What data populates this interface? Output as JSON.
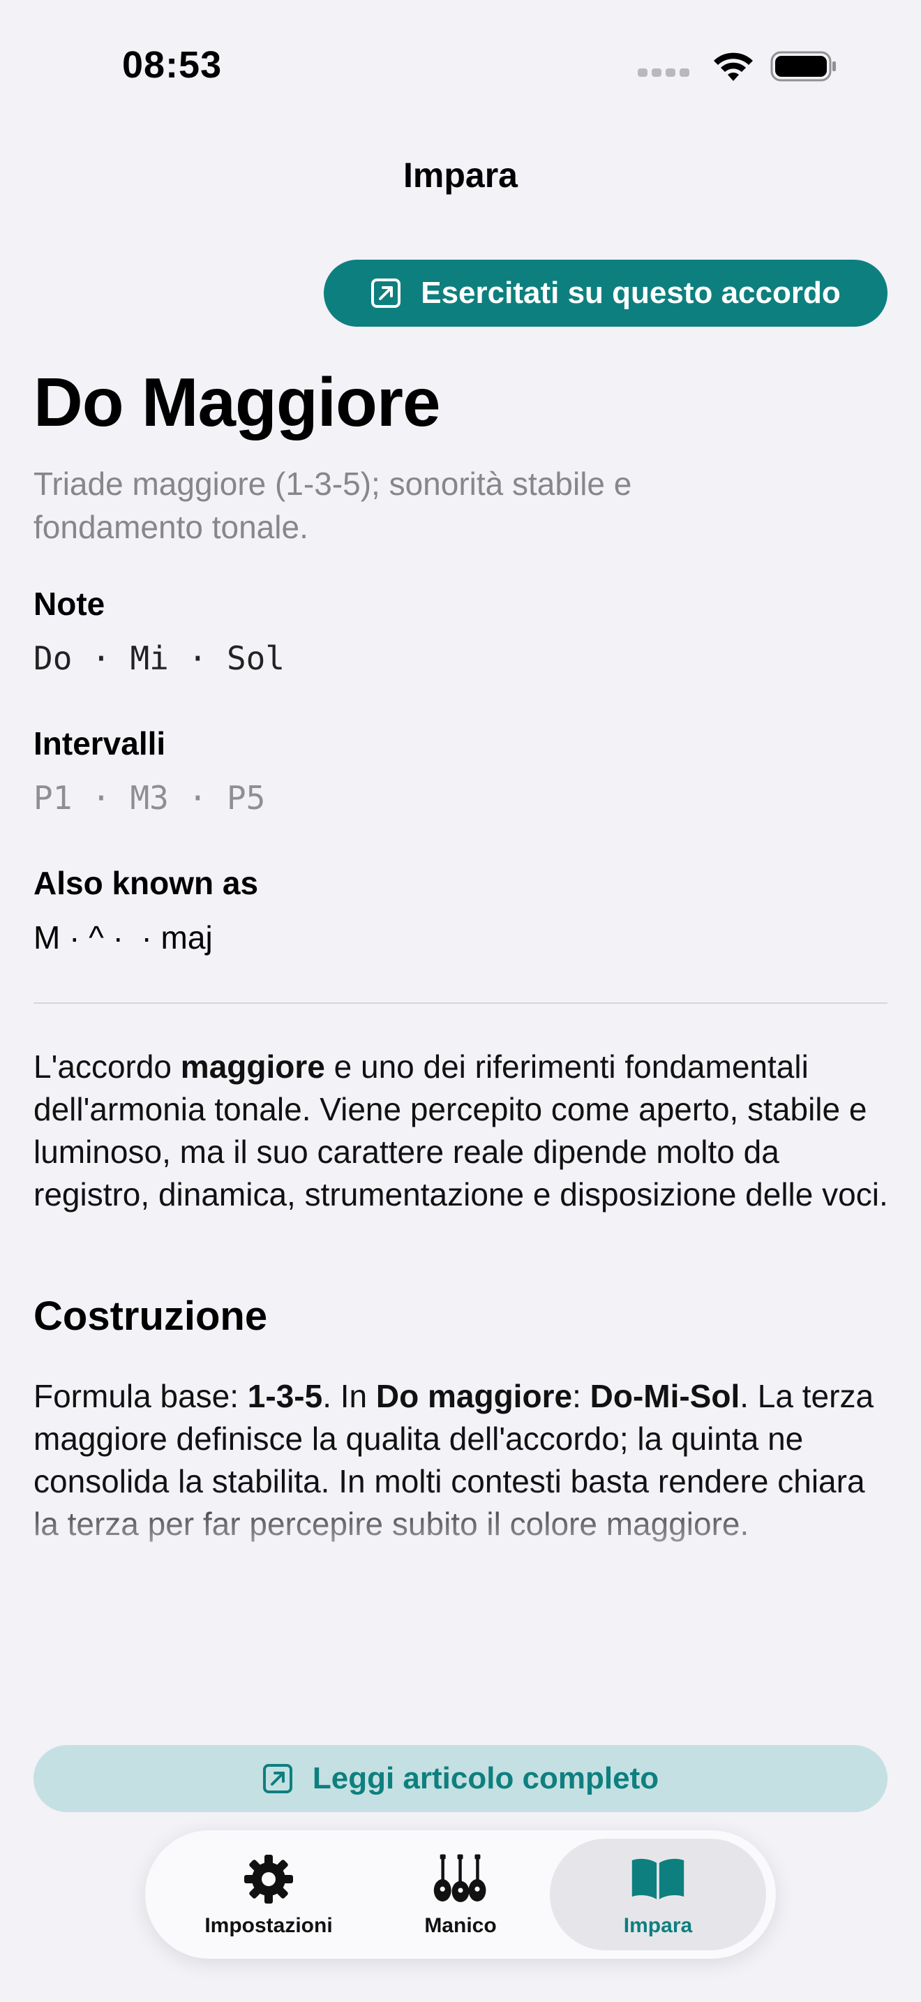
{
  "status": {
    "time": "08:53"
  },
  "nav": {
    "title": "Impara"
  },
  "practice_button": {
    "label": "Esercitati su questo accordo"
  },
  "chord": {
    "name": "Do Maggiore",
    "description": "Triade maggiore (1-3-5); sonorità stabile e fondamento tonale.",
    "notes_label": "Note",
    "notes": "Do · Mi · Sol",
    "intervals_label": "Intervalli",
    "intervals": "P1 · M3 · P5",
    "aka_label": "Also known as",
    "aka": "M · ^ ·  · maj"
  },
  "article": {
    "intro_pre": "L'accordo ",
    "intro_bold": "maggiore",
    "intro_post": " e uno dei riferimenti fondamentali dell'armonia tonale. Viene percepito come aperto, stabile e luminoso, ma il suo carattere reale dipende molto da registro, dinamica, strumentazione e disposizione delle voci.",
    "section_heading": "Costruzione",
    "c_p1": "Formula base: ",
    "c_b1": "1-3-5",
    "c_p2": ". In ",
    "c_b2": "Do maggiore",
    "c_p3": ": ",
    "c_b3": "Do-Mi-Sol",
    "c_p4": ". La terza maggiore definisce la qualita dell'accordo; la quinta ne consolida la stabilita. In molti contesti basta rendere chiara la terza per far percepire subito il colore maggiore."
  },
  "read_button": {
    "label": "Leggi articolo completo"
  },
  "tabs": [
    {
      "label": "Impostazioni",
      "icon": "gear-icon"
    },
    {
      "label": "Manico",
      "icon": "guitars-icon"
    },
    {
      "label": "Impara",
      "icon": "book-icon",
      "active": true
    }
  ],
  "colors": {
    "accent": "#0e7f7f",
    "accent_light": "#c5e0e2",
    "background": "#f2f2f7"
  }
}
